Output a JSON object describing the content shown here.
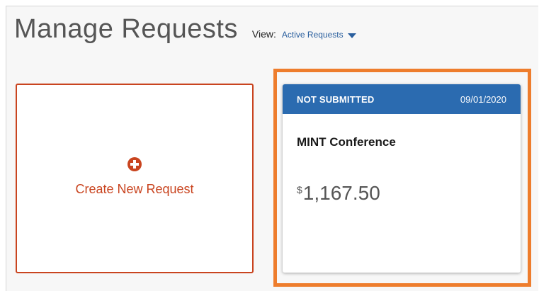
{
  "header": {
    "title": "Manage Requests",
    "view_label": "View:",
    "view_selected": "Active Requests"
  },
  "create_card": {
    "label": "Create New Request",
    "icon": "plus-circle-icon"
  },
  "request_card": {
    "status": "NOT SUBMITTED",
    "date": "09/01/2020",
    "title": "MINT Conference",
    "currency": "$",
    "amount": "1,167.50"
  },
  "colors": {
    "accent_red": "#c9441f",
    "header_blue": "#2b6bb0",
    "highlight_orange": "#ee7d2d",
    "link_blue": "#2a5f9e"
  }
}
